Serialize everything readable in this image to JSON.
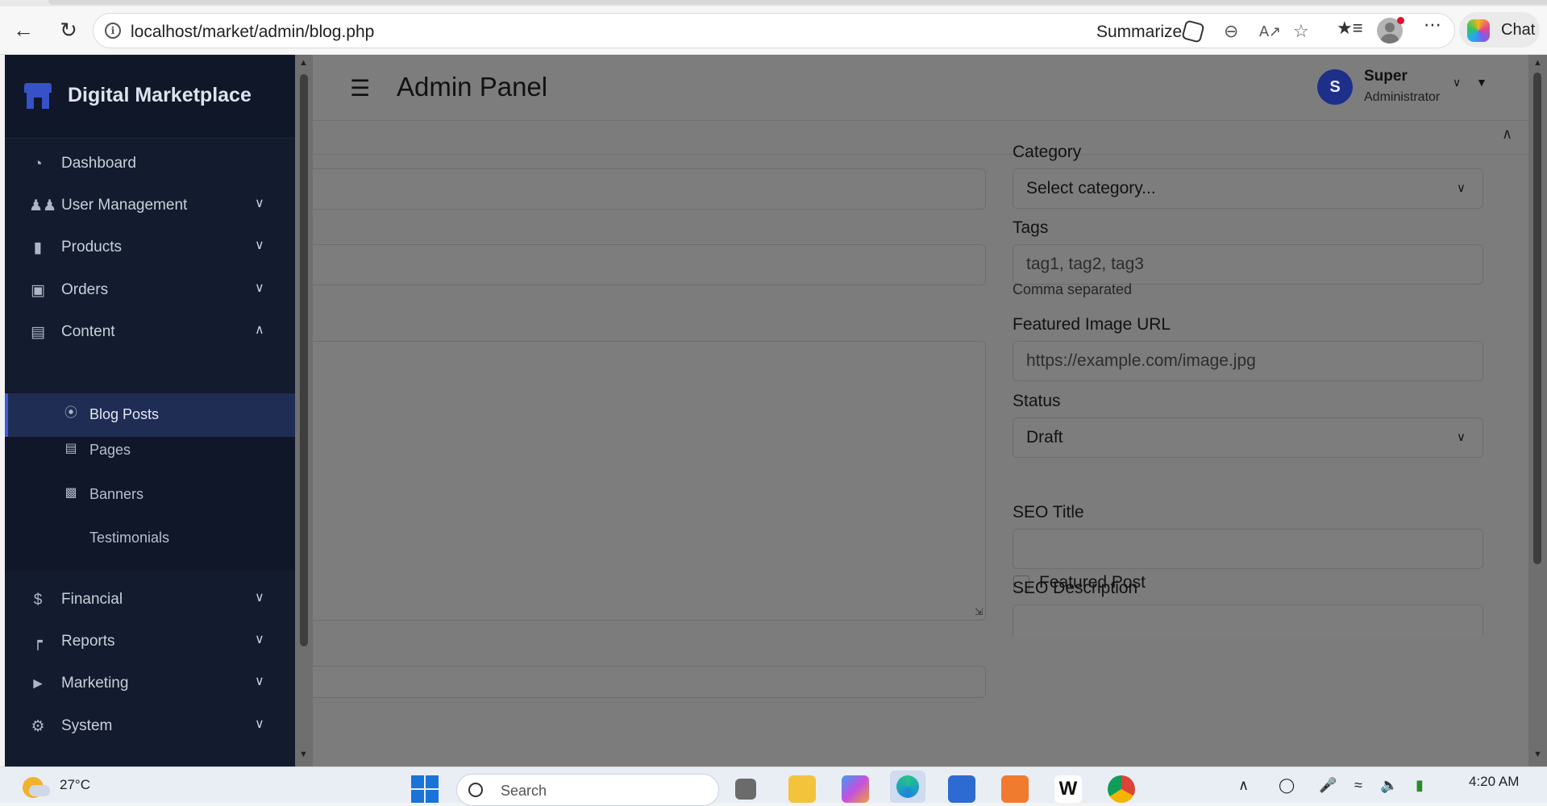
{
  "browser": {
    "url": "localhost/market/admin/blog.php",
    "summarize_label": "Summarize",
    "chat_label": "Chat"
  },
  "sidebar": {
    "brand": "Digital Marketplace",
    "items": [
      {
        "label": "Dashboard",
        "icon": "gauge-icon",
        "has_children": false
      },
      {
        "label": "User Management",
        "icon": "users-icon",
        "has_children": true
      },
      {
        "label": "Products",
        "icon": "box-icon",
        "has_children": true
      },
      {
        "label": "Orders",
        "icon": "shopping-bag-icon",
        "has_children": true
      },
      {
        "label": "Content",
        "icon": "file-icon",
        "has_children": true,
        "expanded": true
      },
      {
        "label": "Financial",
        "icon": "dollar-icon",
        "has_children": true
      },
      {
        "label": "Reports",
        "icon": "chart-icon",
        "has_children": true
      },
      {
        "label": "Marketing",
        "icon": "bullhorn-icon",
        "has_children": true
      },
      {
        "label": "System",
        "icon": "cogs-icon",
        "has_children": true
      }
    ],
    "content_children": [
      {
        "label": "Blog Posts",
        "icon": "blog-icon",
        "active": true
      },
      {
        "label": "Pages",
        "icon": "page-icon",
        "active": false
      },
      {
        "label": "Banners",
        "icon": "image-icon",
        "active": false
      },
      {
        "label": "Testimonials",
        "icon": "",
        "active": false
      }
    ]
  },
  "header": {
    "title": "Admin Panel",
    "user_initial": "S",
    "user_name": "Super",
    "user_role": "Administrator"
  },
  "form": {
    "category": {
      "label": "Category",
      "value": "Select category..."
    },
    "tags": {
      "label": "Tags",
      "placeholder": "tag1, tag2, tag3",
      "help": "Comma separated"
    },
    "featured_image": {
      "label": "Featured Image URL",
      "placeholder": "https://example.com/image.jpg"
    },
    "status": {
      "label": "Status",
      "value": "Draft"
    },
    "featured_post": {
      "label": "Featured Post",
      "checked": false
    },
    "seo_title": {
      "label": "SEO Title",
      "value": ""
    },
    "seo_description": {
      "label": "SEO Description",
      "value": ""
    }
  },
  "taskbar": {
    "temperature": "27°C",
    "search_placeholder": "Search",
    "time": "4:20 AM"
  },
  "colors": {
    "sidebar_bg": "#131b2e",
    "active_item": "#1f2d55",
    "accent": "#3e5ad8",
    "overlay": "#7c7c7c"
  }
}
